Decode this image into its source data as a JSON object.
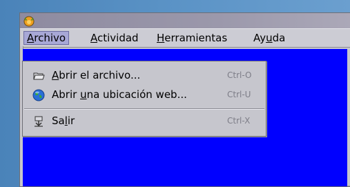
{
  "window": {
    "icon": "app-fox-icon"
  },
  "menubar": {
    "items": [
      {
        "pre": "",
        "mnemonic": "A",
        "post": "rchivo"
      },
      {
        "pre": "",
        "mnemonic": "A",
        "post": "ctividad"
      },
      {
        "pre": "",
        "mnemonic": "H",
        "post": "erramientas"
      },
      {
        "pre": "Ay",
        "mnemonic": "u",
        "post": "da"
      }
    ]
  },
  "dropdown": {
    "items": [
      {
        "icon": "folder-open-icon",
        "pre": "",
        "mnemonic": "A",
        "post": "brir el archivo...",
        "shortcut": "Ctrl-O"
      },
      {
        "icon": "globe-icon",
        "pre": "Abrir ",
        "mnemonic": "u",
        "post": "na ubicación web...",
        "shortcut": "Ctrl-U"
      },
      {
        "icon": "exit-icon",
        "pre": "Sa",
        "mnemonic": "l",
        "post": "ir",
        "shortcut": "Ctrl-X"
      }
    ]
  },
  "colors": {
    "desktop": "#5b93c6",
    "content": "#0000ff",
    "menu_highlight": "#a8a8d6"
  }
}
